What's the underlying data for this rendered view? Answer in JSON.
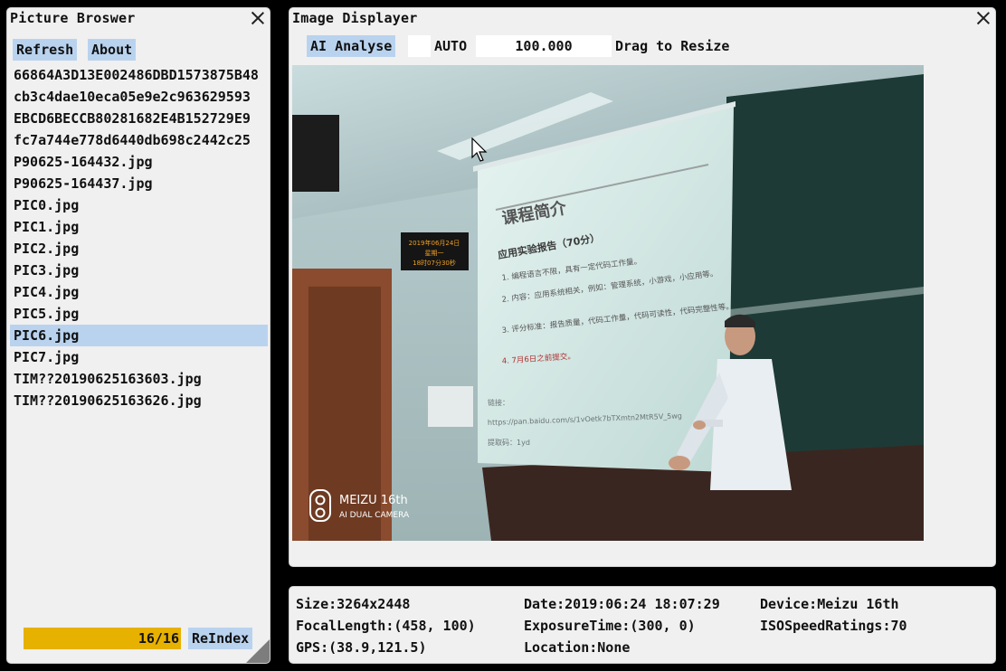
{
  "browser": {
    "title": "Picture Broswer",
    "refresh_label": "Refresh",
    "about_label": "About",
    "files": [
      "66864A3D13E002486DBD1573875B48",
      "cb3c4dae10eca05e9e2c963629593",
      "EBCD6BECCB80281682E4B152729E9",
      "fc7a744e778d6440db698c2442c25",
      "P90625-164432.jpg",
      "P90625-164437.jpg",
      "PIC0.jpg",
      "PIC1.jpg",
      "PIC2.jpg",
      "PIC3.jpg",
      "PIC4.jpg",
      "PIC5.jpg",
      "PIC6.jpg",
      "PIC7.jpg",
      "TIM??20190625163603.jpg",
      "TIM??20190625163626.jpg"
    ],
    "selected_file": "PIC6.jpg",
    "progress_text": "16/16",
    "progress_fraction": 1.0,
    "reindex_label": "ReIndex"
  },
  "displayer": {
    "title": "Image Displayer",
    "ai_label": "AI Analyse",
    "auto_label": "AUTO",
    "zoom_value": "100.000",
    "drag_label": "Drag to Resize",
    "photo": {
      "led_line1": "2019年06月24日",
      "led_line2": "星期一",
      "led_line3": "18时07分30秒",
      "slide_title": "课程简介",
      "slide_subtitle": "应用实验报告（70分）",
      "slide_bullets": [
        "1. 编程语言不限，具有一定代码工作量。",
        "2. 内容：应用系统相关，例如：管理系统，小游戏，小应用等。",
        "3. 评分标准：报告质量，代码工作量，代码可读性，代码完整性等。",
        "4. 7月6日之前提交。"
      ],
      "slide_footer1": "链接：",
      "slide_footer2": "https://pan.baidu.com/s/1vOetk7bTXmtn2MtR5V_5wg",
      "slide_footer3": "提取码：1yd",
      "watermark_brand": "MEIZU 16th",
      "watermark_sub": "AI DUAL CAMERA"
    }
  },
  "info": {
    "size": "Size:3264x2448",
    "date": "Date:2019:06:24 18:07:29",
    "device": "Device:Meizu 16th",
    "focal": "FocalLength:(458, 100)",
    "exposure": "ExposureTime:(300, 0)",
    "iso": "ISOSpeedRatings:70",
    "gps": "GPS:(38.9,121.5)",
    "location": "Location:None"
  },
  "colors": {
    "accent": "#b9d3ef",
    "progress": "#e7b100",
    "background": "#000000",
    "panel": "#f0f0f0"
  },
  "icons": [
    "close-icon",
    "mouse-cursor-icon",
    "resize-grip-icon",
    "camera-lens-icon"
  ]
}
